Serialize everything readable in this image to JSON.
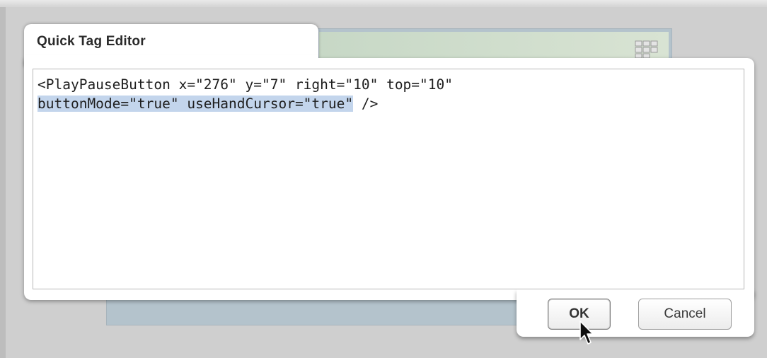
{
  "dialog": {
    "title": "Quick Tag Editor",
    "editor": {
      "line1": "<PlayPauseButton x=\"276\" y=\"7\" right=\"10\" top=\"10\"",
      "line2_selected": "buttonMode=\"true\" useHandCursor=\"true\"",
      "line2_rest": " />"
    },
    "buttons": {
      "ok_label": "OK",
      "cancel_label": "Cancel"
    }
  },
  "colors": {
    "selection": "#c3d5ec",
    "background": "#cfcfcf"
  },
  "icons": {
    "grid": "grid-icon",
    "cursor": "mouse-pointer-icon"
  }
}
